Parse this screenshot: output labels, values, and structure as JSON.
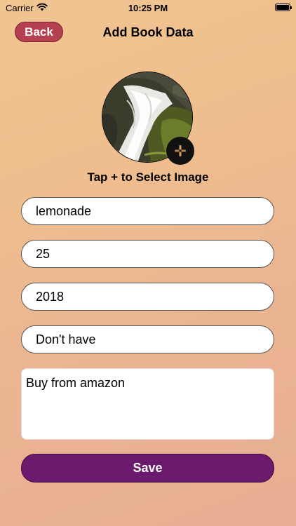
{
  "status_bar": {
    "carrier": "Carrier",
    "time": "10:25 PM"
  },
  "nav": {
    "back_label": "Back",
    "title": "Add Book Data"
  },
  "image_picker": {
    "image": "waterfall-photo",
    "add_icon": "plus-icon",
    "hint": "Tap + to Select Image"
  },
  "form": {
    "title_value": "lemonade",
    "price_value": "25",
    "year_value": "2018",
    "status_value": "Don't have",
    "notes_value": "Buy from amazon",
    "save_label": "Save"
  },
  "colors": {
    "back_button": "#b5404f",
    "save_button": "#6b1a6e",
    "background_top": "#f0c590",
    "background_bottom": "#e7ad93"
  }
}
